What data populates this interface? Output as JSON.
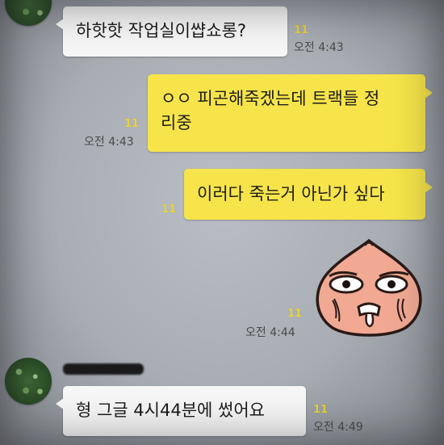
{
  "messages": [
    {
      "text": "하핫핫 작업실이썁쇼롱?",
      "unread": "11",
      "time": "오전 4:43"
    },
    {
      "text": "ㅇㅇ 피곤해죽겠는데 트랙들 정리중",
      "line1": "ㅇㅇ 피곤해죽겠는데 트랙들 정",
      "line2": "리중",
      "unread": "11",
      "time": "오전 4:43"
    },
    {
      "text": "이러다 죽는거 아닌가 싶다",
      "unread": "11"
    },
    {
      "sticker": "peach-character-sticker",
      "unread": "11",
      "time": "오전 4:44"
    },
    {
      "text": "형 그글 4시44분에 썼어요",
      "unread": "11",
      "time": "오전 4:49"
    }
  ],
  "colors": {
    "background": "#aeb3b9",
    "incoming_bubble": "#f7f7f7",
    "outgoing_bubble": "#f6e44a",
    "unread_count": "#e8d23a"
  }
}
